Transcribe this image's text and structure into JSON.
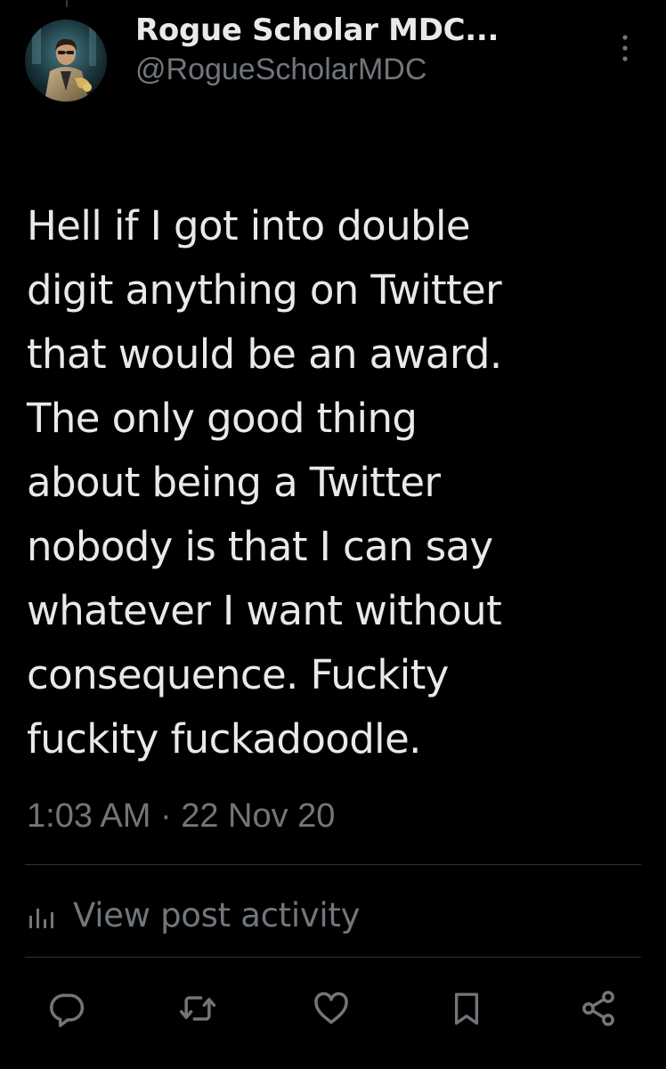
{
  "author": {
    "display_name": "Rogue Scholar MDC...",
    "handle": "@RogueScholarMDC",
    "avatar": "avatar-image"
  },
  "post": {
    "text": "Hell if I got into double\ndigit anything on Twitter\nthat would be an award.\nThe only good thing\nabout being a Twitter\nnobody is that I can say\nwhatever I want without\nconsequence. Fuckity\nfuckity fuckadoodle.",
    "timestamp": "1:03 AM · 22 Nov 20"
  },
  "activity": {
    "label": "View post activity",
    "icon": "bar-chart-icon"
  },
  "actions": [
    {
      "name": "reply",
      "icon": "reply-icon"
    },
    {
      "name": "repost",
      "icon": "repost-icon"
    },
    {
      "name": "like",
      "icon": "heart-icon"
    },
    {
      "name": "bookmark",
      "icon": "bookmark-icon"
    },
    {
      "name": "share",
      "icon": "share-icon"
    }
  ],
  "colors": {
    "background": "#000000",
    "primary_text": "#e7e9ea",
    "secondary_text": "#71767b",
    "divider": "#2f3336"
  }
}
